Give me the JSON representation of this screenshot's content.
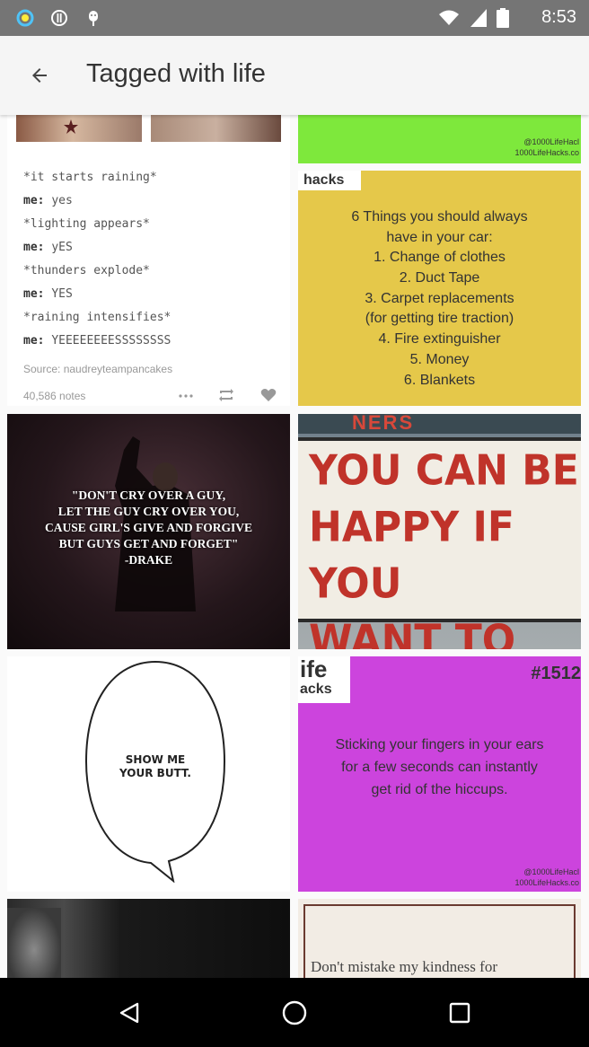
{
  "status_bar": {
    "time": "8:53"
  },
  "header": {
    "title": "Tagged with life"
  },
  "posts": {
    "text_post": {
      "lines": [
        {
          "speaker": "",
          "text": "*it starts raining*"
        },
        {
          "speaker": "me:",
          "text": "yes"
        },
        {
          "speaker": "",
          "text": "*lighting appears*"
        },
        {
          "speaker": "me:",
          "text": "yES"
        },
        {
          "speaker": "",
          "text": "*thunders explode*"
        },
        {
          "speaker": "me:",
          "text": "YES"
        },
        {
          "speaker": "",
          "text": "*raining intensifies*"
        },
        {
          "speaker": "me:",
          "text": "YEEEEEEEESSSSSSSS"
        }
      ],
      "source": "Source: naudreyteampancakes",
      "notes": "40,586 notes"
    },
    "hack_top": {
      "watermark_handle": "@1000LifeHacl",
      "watermark_site": "1000LifeHacks.co"
    },
    "hack_car": {
      "corner": "hacks",
      "heading": "6 Things you should always\nhave in your car:",
      "items": [
        "1. Change of clothes",
        "2. Duct Tape",
        "3. Carpet replacements",
        "(for getting tire traction)",
        "4. Fire extinguisher",
        "5. Money",
        "6. Blankets"
      ],
      "color": "#e5c84a"
    },
    "drake_quote": {
      "lines": [
        "\"DON'T CRY OVER A GUY,",
        "LET THE GUY CRY OVER YOU,",
        "CAUSE GIRL'S GIVE AND FORGIVE",
        "BUT GUYS GET AND FORGET\"",
        "-DRAKE"
      ]
    },
    "marquee": {
      "top_sign": "NERS",
      "lines": [
        "YOU CAN BE",
        "HAPPY IF YOU",
        "WANT TO BE"
      ]
    },
    "speech_bubble": {
      "text": "SHOW ME\nYOUR BUTT."
    },
    "hack_hiccups": {
      "corner_line1": "ife",
      "corner_line2": "acks",
      "number": "#1512",
      "body": "Sticking your fingers in your ears\nfor a few seconds can instantly\nget rid of the hiccups.",
      "watermark_handle": "@1000LifeHacl",
      "watermark_site": "1000LifeHacks.co",
      "color": "#cc44dd"
    },
    "bottom_right": {
      "text": "Don't mistake my kindness for"
    }
  },
  "colors": {
    "status_bar": "#757575",
    "app_bar": "#f5f5f5",
    "lime": "#7ee83c",
    "nav_bar": "#000000"
  }
}
